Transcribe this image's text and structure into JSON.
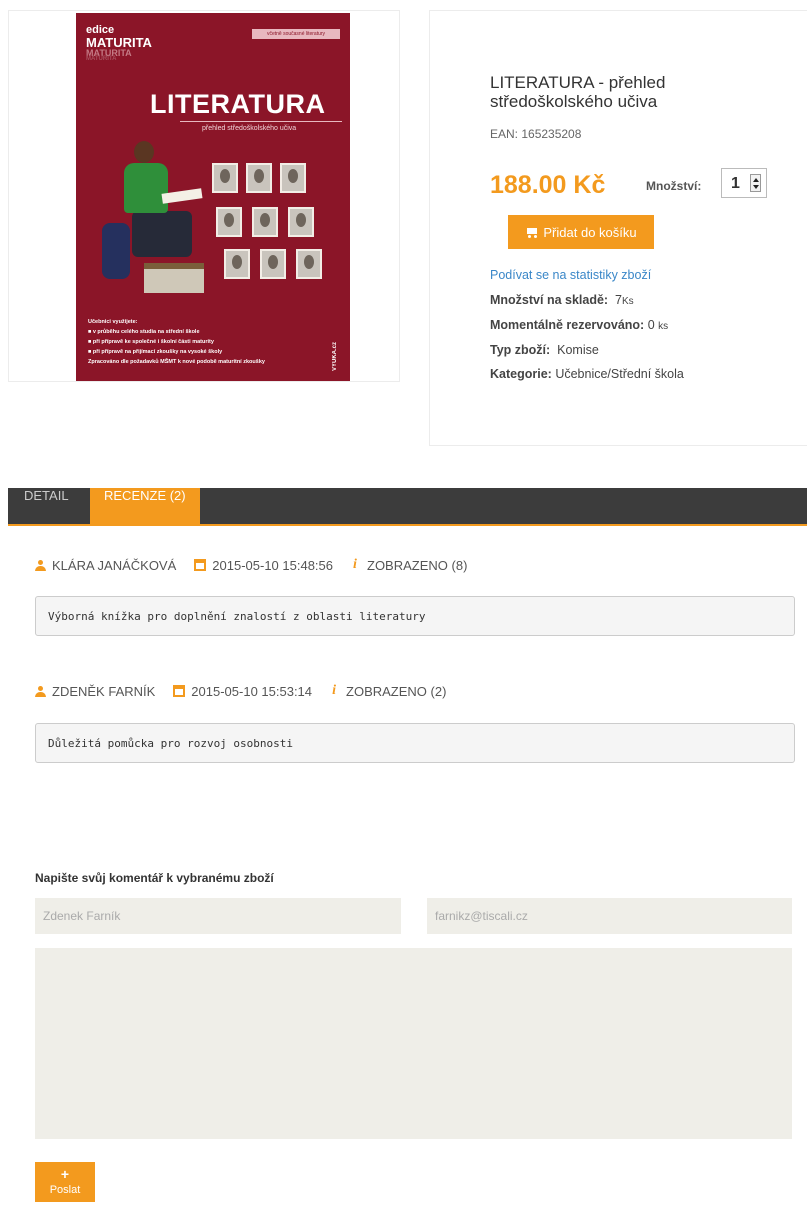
{
  "product": {
    "title": "LITERATURA - přehled středoškolského učiva",
    "ean": "EAN: 165235208",
    "price": "188.00 Kč",
    "quantity_label": "Množství:",
    "quantity_value": "1",
    "add_to_cart_label": "Přidat do košíku",
    "stats_link": "Podívat se na statistiky zboží",
    "stock_label": "Množství na skladě:",
    "stock_value": "7",
    "stock_unit": "Ks",
    "reserved_label": "Momentálně rezervováno:",
    "reserved_value": "0",
    "reserved_unit": "ks",
    "type_label": "Typ zboží:",
    "type_value": "Komise",
    "category_label": "Kategorie:",
    "category_value": "Učebnice/Střední škola"
  },
  "cover": {
    "edice": "edice",
    "series": "MATURITA",
    "tag": "včetně současné literatury",
    "big_title": "LITERATURA",
    "subtitle": "přehled středoškolského učiva",
    "bullets_title": "Učebnici využijete:",
    "bullet_1": "■ v průběhu celého studia na střední škole",
    "bullet_2": "■ při přípravě ke společné i školní části maturity",
    "bullet_3": "■ při přípravě na přijímací zkoušky na vysoké školy",
    "footer_note": "Zpracováno dle požadavků MŠMT k nové podobě maturitní zkoušky",
    "publisher": "VYUKA.cz"
  },
  "tabs": {
    "detail": "DETAIL",
    "reviews": "RECENZE (2)"
  },
  "reviews": [
    {
      "author": "KLÁRA JANÁČKOVÁ",
      "date": "2015-05-10 15:48:56",
      "views": "ZOBRAZENO (8)",
      "text": "Výborná knížka pro doplnění znalostí z oblasti literatury"
    },
    {
      "author": "ZDENĚK FARNÍK",
      "date": "2015-05-10 15:53:14",
      "views": "ZOBRAZENO (2)",
      "text": "Důležitá pomůcka pro rozvoj osobnosti"
    }
  ],
  "comment_form": {
    "title": "Napište svůj komentář k vybranému zboží",
    "name_value": "Zdenek Farník",
    "email_value": "farnikz@tiscali.cz",
    "message_value": "",
    "submit_label": "Poslat",
    "submit_icon": "+"
  },
  "colors": {
    "accent": "#f39a1e",
    "tabbar": "#3c3c3c",
    "link": "#3a87c8",
    "cover": "#8b1528"
  }
}
